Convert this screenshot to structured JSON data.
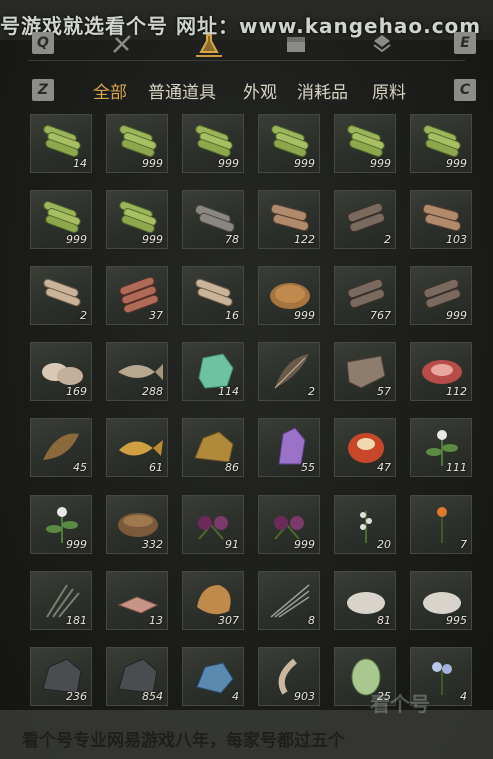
{
  "watermark_top": "号游戏就选看个号  网址：www.kangehao.com",
  "watermark_bottom": "看个号专业网易游戏八年，每家号都过五个",
  "watermark_logo": "看个号",
  "keys": {
    "left_top": "Q",
    "right_top": "E",
    "left_filter": "Z",
    "right_filter": "C"
  },
  "top_tabs": [
    {
      "icon": "pickaxe-icon"
    },
    {
      "icon": "crossed-swords-icon"
    },
    {
      "icon": "flask-icon",
      "active": true
    },
    {
      "icon": "chest-icon"
    },
    {
      "icon": "gem-stack-icon"
    }
  ],
  "filter_tabs": [
    {
      "label": "全部",
      "active": true
    },
    {
      "label": "普通道具"
    },
    {
      "label": "外观"
    },
    {
      "label": "消耗品"
    },
    {
      "label": "原料"
    }
  ],
  "accent_color": "#d9a64a",
  "items": [
    {
      "icon": "bamboo-icon",
      "qty": "14"
    },
    {
      "icon": "bamboo-icon",
      "qty": "999"
    },
    {
      "icon": "bamboo-icon",
      "qty": "999"
    },
    {
      "icon": "bamboo-icon",
      "qty": "999"
    },
    {
      "icon": "bamboo-icon",
      "qty": "999"
    },
    {
      "icon": "bamboo-icon",
      "qty": "999"
    },
    {
      "icon": "bamboo-icon",
      "qty": "999"
    },
    {
      "icon": "bamboo-icon",
      "qty": "999"
    },
    {
      "icon": "gray-log-icon",
      "qty": "78"
    },
    {
      "icon": "log-icon",
      "qty": "122"
    },
    {
      "icon": "dark-log-icon",
      "qty": "2"
    },
    {
      "icon": "log-icon",
      "qty": "103"
    },
    {
      "icon": "pale-log-icon",
      "qty": "2"
    },
    {
      "icon": "red-log-icon",
      "qty": "37"
    },
    {
      "icon": "pale-log-icon",
      "qty": "16"
    },
    {
      "icon": "hay-icon",
      "qty": "999"
    },
    {
      "icon": "dark-log-icon",
      "qty": "767"
    },
    {
      "icon": "dark-log-icon",
      "qty": "999"
    },
    {
      "icon": "shell-icon",
      "qty": "169"
    },
    {
      "icon": "fish-icon",
      "qty": "288"
    },
    {
      "icon": "jade-icon",
      "qty": "114"
    },
    {
      "icon": "feather-icon",
      "qty": "2"
    },
    {
      "icon": "hide-icon",
      "qty": "57"
    },
    {
      "icon": "meat-icon",
      "qty": "112"
    },
    {
      "icon": "catfish-icon",
      "qty": "45"
    },
    {
      "icon": "carp-icon",
      "qty": "61"
    },
    {
      "icon": "ore-icon",
      "qty": "86"
    },
    {
      "icon": "amethyst-icon",
      "qty": "55"
    },
    {
      "icon": "chestnut-icon",
      "qty": "47"
    },
    {
      "icon": "herb-flower-icon",
      "qty": "111"
    },
    {
      "icon": "herb-flower-icon",
      "qty": "999"
    },
    {
      "icon": "mortar-icon",
      "qty": "332"
    },
    {
      "icon": "purple-flower-icon",
      "qty": "91"
    },
    {
      "icon": "purple-flower-icon",
      "qty": "999"
    },
    {
      "icon": "white-flower-icon",
      "qty": "20"
    },
    {
      "icon": "orange-flower-icon",
      "qty": "7"
    },
    {
      "icon": "grass-icon",
      "qty": "181"
    },
    {
      "icon": "raw-meat-icon",
      "qty": "13"
    },
    {
      "icon": "fur-icon",
      "qty": "307"
    },
    {
      "icon": "quill-icon",
      "qty": "8"
    },
    {
      "icon": "white-fluff-icon",
      "qty": "81"
    },
    {
      "icon": "white-fluff-icon",
      "qty": "995"
    },
    {
      "icon": "dark-ore-icon",
      "qty": "236"
    },
    {
      "icon": "dark-ore-icon",
      "qty": "854"
    },
    {
      "icon": "blue-crystal-icon",
      "qty": "4"
    },
    {
      "icon": "bone-icon",
      "qty": "903"
    },
    {
      "icon": "melon-icon",
      "qty": "25"
    },
    {
      "icon": "blue-flower-icon",
      "qty": "4"
    }
  ]
}
